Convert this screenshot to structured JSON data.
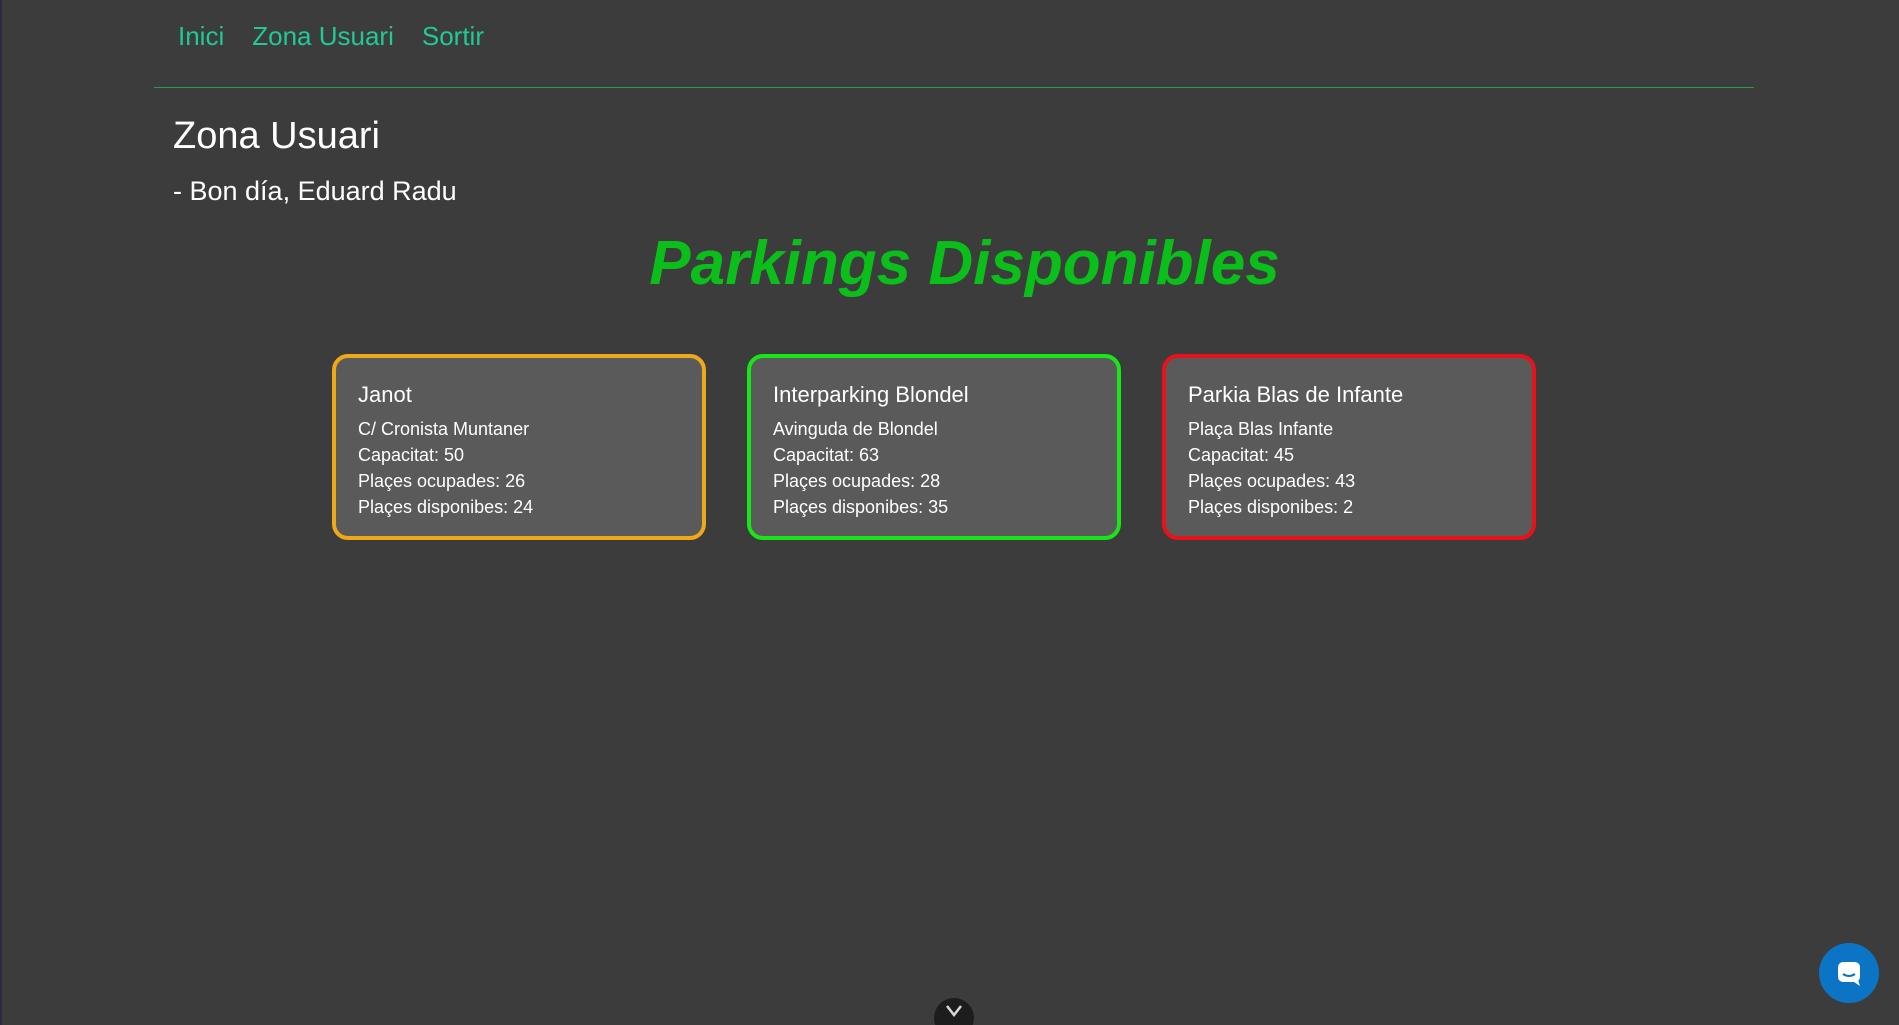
{
  "nav": {
    "links": [
      "Inici",
      "Zona Usuari",
      "Sortir"
    ]
  },
  "page": {
    "heading": "Zona Usuari",
    "greeting": "- Bon día, Eduard Radu",
    "title": "Parkings Disponibles"
  },
  "parkings": [
    {
      "name": "Janot",
      "address": "C/ Cronista Muntaner",
      "capacity": "Capacitat: 50",
      "occupied": "Plaçes ocupades: 26",
      "available": "Plaçes disponibes: 24",
      "status_color": "#f0a81b"
    },
    {
      "name": "Interparking Blondel",
      "address": "Avinguda de Blondel",
      "capacity": "Capacitat: 63",
      "occupied": "Plaçes ocupades: 28",
      "available": "Plaçes disponibes: 35",
      "status_color": "#19e619"
    },
    {
      "name": "Parkia Blas de Infante",
      "address": "Plaça Blas Infante",
      "capacity": "Capacitat: 45",
      "occupied": "Plaçes ocupades: 43",
      "available": "Plaçes disponibes: 2",
      "status_color": "#e8121c"
    }
  ],
  "widgets": {
    "chat_icon": "chat-bubble-icon",
    "scroll_icon": "chevron-down-icon"
  },
  "colors": {
    "background": "#3c3c3c",
    "nav_link": "#20c997",
    "title": "#0bbf1b",
    "card_bg": "#5a5a5a",
    "chat_button": "#0c74c4"
  }
}
